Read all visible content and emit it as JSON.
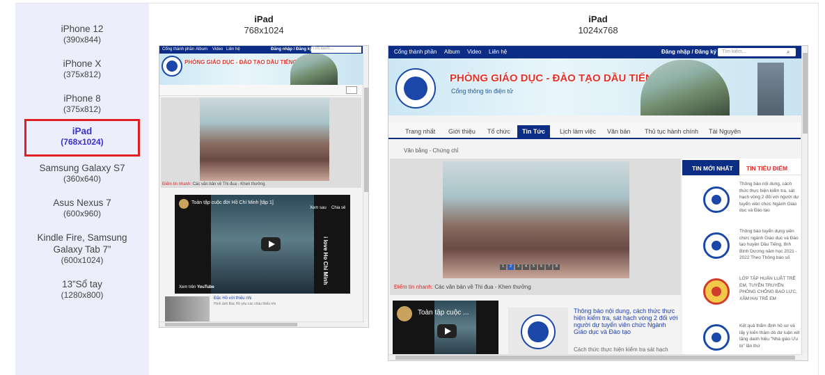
{
  "devices": [
    {
      "name": "iPhone 12",
      "res": "(390x844)"
    },
    {
      "name": "iPhone X",
      "res": "(375x812)"
    },
    {
      "name": "iPhone 8",
      "res": "(375x812)"
    },
    {
      "name": "iPad",
      "res": "(768x1024)"
    },
    {
      "name": "Samsung Galaxy S7",
      "res": "(360x640)"
    },
    {
      "name": "Asus Nexus 7",
      "res": "(600x960)"
    },
    {
      "name": "Kindle Fire, Samsung",
      "name2": "Galaxy Tab 7”",
      "res": "(600x1024)"
    },
    {
      "name": "13”Sổ tay",
      "res": "(1280x800)"
    }
  ],
  "previews": {
    "portrait": {
      "title": "iPad",
      "res": "768x1024"
    },
    "landscape": {
      "title": "iPad",
      "res": "1024x768"
    }
  },
  "site": {
    "nav": [
      "Cổng thành phần",
      "Album",
      "Video",
      "Liên hệ"
    ],
    "login": "Đăng nhập / Đăng ký",
    "search_placeholder": "Tìm kiếm...",
    "banner_title": "PHÒNG GIÁO DỤC - ĐÀO TẠO DẦU TIẾNG",
    "banner_sub": "Cổng thông tin điện tử",
    "menu": [
      "Trang nhất",
      "Giới thiệu",
      "Tổ chức",
      "Tin Tức",
      "Lịch làm việc",
      "Văn bản",
      "Thủ tục hành chính",
      "Tài Nguyên"
    ],
    "breadcrumb": "Văn bằng - Chứng chỉ",
    "news_label": "Điểm tin nhanh:",
    "news_text": "Các văn bản về Thi đua - Khen thưởng",
    "video_title": "Toàn tập cuộc đời Hồ Chí Minh [tập 1]",
    "video_title_short": "Toàn tập cuộc ...",
    "watch_later": "Xem sau",
    "share": "Chia sẻ",
    "watch_on": "Xem trên",
    "youtube": "YouTube",
    "video_overlay": "i love Ho Chi Minh",
    "tab_new": "TIN MỚI NHẤT",
    "tab_focus": "TIN TIÊU ĐIỂM",
    "side_items": [
      "Thông báo nội dung, cách thức thực hiện kiểm tra, sát hạch vòng 2 đối với người dự tuyển viên chức Ngành Giáo dục và Đào tạo",
      "Thông báo tuyển dụng viên chức ngành Giáo dục và Đào tạo huyện Dầu Tiếng, tỉnh Bình Dương năm học 2021 - 2022 Theo Thông báo số",
      "LỚP TẬP HUẤN LUẬT TRẺ EM, TUYÊN TRUYỀN PHÒNG CHỐNG BẠO LỰC, XÂM HẠI TRẺ EM",
      "Kết quả thẩm định hồ sơ và lấy ý kiến thăm dò dư luận xét tặng danh hiệu \"Nhà giáo Ưu tú\" lần thứ"
    ],
    "article_title": "Thông báo nội dung, cách thức thực hiện kiểm tra, sát hạch vòng 2 đối với người dự tuyển viên chức Ngành Giáo dục và Đào tạo",
    "article_body": "Cách thức thực hiện kiểm tra sát hạch",
    "small_item_title": "Đặc Hồ với thiếu nhi",
    "small_item_text": "Hình ảnh Bác Hồ yêu các cháu thiếu nhi",
    "slides": [
      "1",
      "2",
      "3",
      "4",
      "5",
      "6",
      "7",
      "8"
    ]
  },
  "colors": {
    "accent": "#3a2fd0",
    "highlight": "#e02020",
    "site_nav": "#0b2d86",
    "sidebar_bg": "#edeefb"
  }
}
